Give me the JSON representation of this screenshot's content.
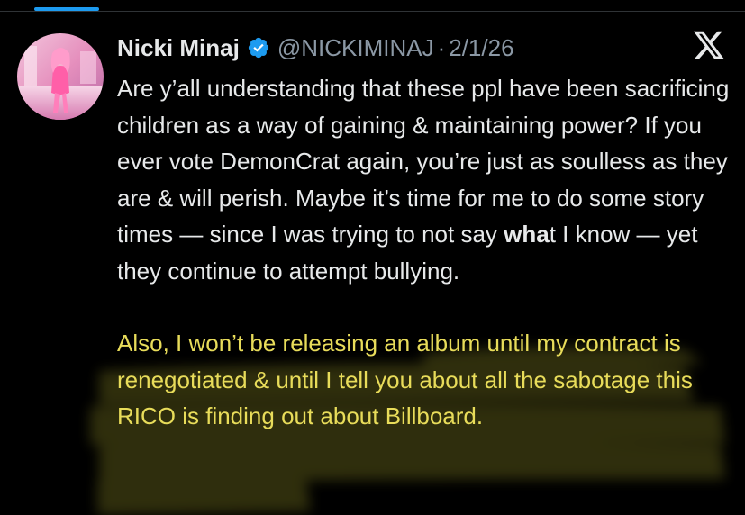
{
  "tweet": {
    "display_name": "Nicki Minaj",
    "handle": "@NICKIMINAJ",
    "separator": "·",
    "date": "2/1/26",
    "paragraphs": [
      {
        "before": "Are y’all understanding that these ppl have been sacrificing children as a way of gaining & maintaining power? If you ever vote DemonCrat again, you’re just as soulless as they are & will perish. Maybe it’s time for me to do some story times — since I was trying to not say ",
        "bold": "wha",
        "after": "t I know — yet they continue to attempt bullying."
      },
      {
        "text": "Also, I won’t be releasing an album until my contract is renegotiated & until I tell you about all the sabotage this RICO is finding out about Billboard."
      }
    ]
  },
  "icons": {
    "verified": "verified-badge-icon",
    "brand": "x-logo-icon"
  },
  "colors": {
    "background": "#000000",
    "text": "#e7e9ea",
    "muted": "#8b98a5",
    "accent": "#1d9bf0",
    "highlight_text": "#e8dc5a",
    "highlighter": "#d6d13a"
  }
}
